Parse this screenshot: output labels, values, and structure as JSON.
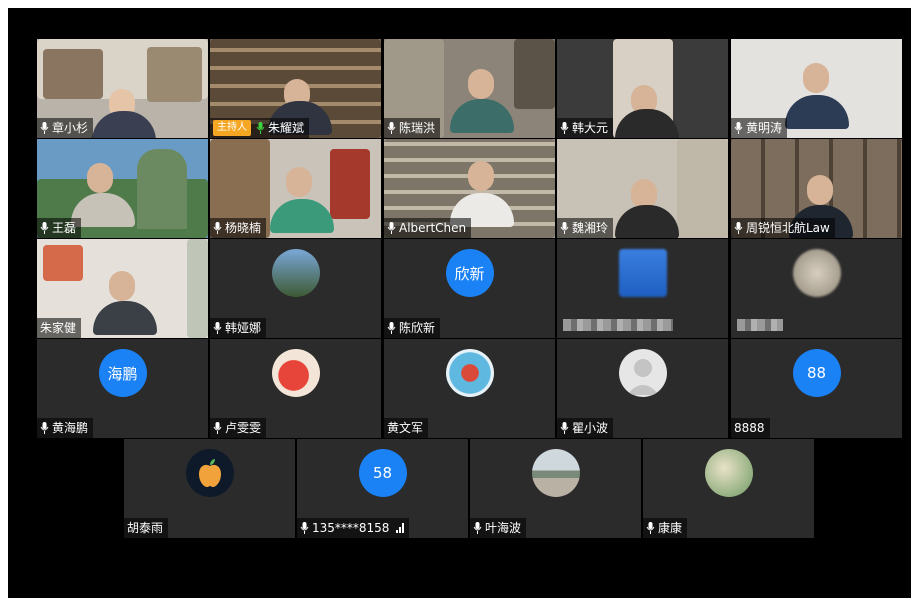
{
  "participants": [
    {
      "name": "章小杉",
      "mic": true
    },
    {
      "name": "朱耀斌",
      "mic": true,
      "badge": "主持人"
    },
    {
      "name": "陈瑞洪",
      "mic": true
    },
    {
      "name": "韩大元",
      "mic": true
    },
    {
      "name": "黄明涛",
      "mic": true
    },
    {
      "name": "王磊",
      "mic": true
    },
    {
      "name": "杨晓楠",
      "mic": true
    },
    {
      "name": "AlbertChen",
      "mic": true
    },
    {
      "name": "魏湘玲",
      "mic": true
    },
    {
      "name": "周锐恒北航Law",
      "mic": true
    },
    {
      "name": "朱家健",
      "mic": false
    },
    {
      "name": "韩娅娜",
      "mic": true
    },
    {
      "name": "陈欣新",
      "mic": true,
      "avatar_text": "欣新"
    },
    {
      "name": "",
      "mic": false
    },
    {
      "name": "",
      "mic": false
    },
    {
      "name": "黄海鹏",
      "mic": true,
      "avatar_text": "海鹏"
    },
    {
      "name": "卢雯雯",
      "mic": true
    },
    {
      "name": "黄文军",
      "mic": false
    },
    {
      "name": "瞿小波",
      "mic": true
    },
    {
      "name": "8888",
      "mic": false,
      "avatar_text": "88"
    },
    {
      "name": "胡泰雨",
      "mic": false
    },
    {
      "name": "135****8158",
      "mic": true,
      "avatar_text": "58"
    },
    {
      "name": "叶海波",
      "mic": true
    },
    {
      "name": "康康",
      "mic": true
    }
  ],
  "colors": {
    "avatar_blue": "#1b82f5",
    "host_badge": "#f5a623",
    "tile_bg": "#2b2b2b",
    "background": "#000000"
  }
}
